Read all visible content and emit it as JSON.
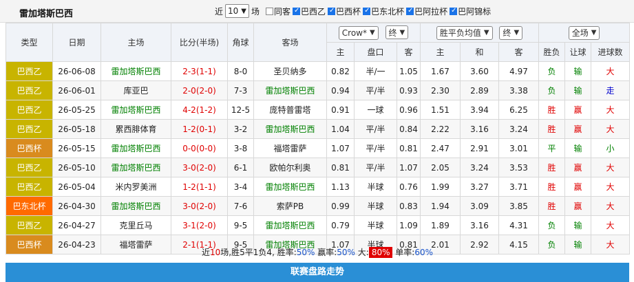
{
  "team_name": "雷加塔斯巴西",
  "filters": {
    "recent_label": "近",
    "count_value": "10",
    "unit_label": "场",
    "same_home_label": "同客",
    "same_home_checked": false,
    "leagues": [
      {
        "label": "巴西乙",
        "checked": true
      },
      {
        "label": "巴西杯",
        "checked": true
      },
      {
        "label": "巴东北杯",
        "checked": true
      },
      {
        "label": "巴阿拉杯",
        "checked": true
      },
      {
        "label": "巴阿锦标",
        "checked": true
      }
    ]
  },
  "headers": {
    "type": "类型",
    "date": "日期",
    "home": "主场",
    "score": "比分(半场)",
    "corner": "角球",
    "away": "客场",
    "bookmaker_select": "Crow*",
    "asian_period_select": "终",
    "eu_type_select": "胜平负均值",
    "eu_period_select": "终",
    "range_select": "全场",
    "asian_sub": [
      "主",
      "盘口",
      "客"
    ],
    "eu_sub": [
      "主",
      "和",
      "客"
    ],
    "result_sub": [
      "胜负",
      "让球",
      "进球数"
    ]
  },
  "league_colors": {
    "巴西乙": "#c8b400",
    "巴西杯": "#d98b1e",
    "巴东北杯": "#ff6a00"
  },
  "matches": [
    {
      "league": "巴西乙",
      "date": "26-06-08",
      "home": "雷加塔斯巴西",
      "score": "2-3(1-1)",
      "corner": "8-0",
      "away": "圣贝纳多",
      "a_home": "0.82",
      "handicap": "半/一",
      "a_away": "1.05",
      "e_home": "1.67",
      "e_draw": "3.60",
      "e_away": "4.97",
      "res": "负",
      "hcp_res": "输",
      "goal_res": "大"
    },
    {
      "league": "巴西乙",
      "date": "26-06-01",
      "home": "库亚巴",
      "score": "2-0(2-0)",
      "corner": "7-3",
      "away": "雷加塔斯巴西",
      "a_home": "0.94",
      "handicap": "平/半",
      "a_away": "0.93",
      "e_home": "2.30",
      "e_draw": "2.89",
      "e_away": "3.38",
      "res": "负",
      "hcp_res": "输",
      "goal_res": "走"
    },
    {
      "league": "巴西乙",
      "date": "26-05-25",
      "home": "雷加塔斯巴西",
      "score": "4-2(1-2)",
      "corner": "12-5",
      "away": "庞特普雷塔",
      "a_home": "0.91",
      "handicap": "一球",
      "a_away": "0.96",
      "e_home": "1.51",
      "e_draw": "3.94",
      "e_away": "6.25",
      "res": "胜",
      "hcp_res": "赢",
      "goal_res": "大"
    },
    {
      "league": "巴西乙",
      "date": "26-05-18",
      "home": "累西腓体育",
      "score": "1-2(0-1)",
      "corner": "3-2",
      "away": "雷加塔斯巴西",
      "a_home": "1.04",
      "handicap": "平/半",
      "a_away": "0.84",
      "e_home": "2.22",
      "e_draw": "3.16",
      "e_away": "3.24",
      "res": "胜",
      "hcp_res": "赢",
      "goal_res": "大"
    },
    {
      "league": "巴西杯",
      "date": "26-05-15",
      "home": "雷加塔斯巴西",
      "score": "0-0(0-0)",
      "corner": "3-8",
      "away": "福塔雷萨",
      "a_home": "1.07",
      "handicap": "平/半",
      "a_away": "0.81",
      "e_home": "2.47",
      "e_draw": "2.91",
      "e_away": "3.01",
      "res": "平",
      "hcp_res": "输",
      "goal_res": "小"
    },
    {
      "league": "巴西乙",
      "date": "26-05-10",
      "home": "雷加塔斯巴西",
      "score": "3-0(2-0)",
      "corner": "6-1",
      "away": "欧帕尔利奥",
      "a_home": "0.81",
      "handicap": "平/半",
      "a_away": "1.07",
      "e_home": "2.05",
      "e_draw": "3.24",
      "e_away": "3.53",
      "res": "胜",
      "hcp_res": "赢",
      "goal_res": "大"
    },
    {
      "league": "巴西乙",
      "date": "26-05-04",
      "home": "米内罗美洲",
      "score": "1-2(1-1)",
      "corner": "3-4",
      "away": "雷加塔斯巴西",
      "a_home": "1.13",
      "handicap": "半球",
      "a_away": "0.76",
      "e_home": "1.99",
      "e_draw": "3.27",
      "e_away": "3.71",
      "res": "胜",
      "hcp_res": "赢",
      "goal_res": "大"
    },
    {
      "league": "巴东北杯",
      "date": "26-04-30",
      "home": "雷加塔斯巴西",
      "score": "3-0(2-0)",
      "corner": "7-6",
      "away": "索萨PB",
      "a_home": "0.99",
      "handicap": "半球",
      "a_away": "0.83",
      "e_home": "1.94",
      "e_draw": "3.09",
      "e_away": "3.85",
      "res": "胜",
      "hcp_res": "赢",
      "goal_res": "大"
    },
    {
      "league": "巴西乙",
      "date": "26-04-27",
      "home": "克里丘马",
      "score": "3-1(2-0)",
      "corner": "9-5",
      "away": "雷加塔斯巴西",
      "a_home": "0.79",
      "handicap": "半球",
      "a_away": "1.09",
      "e_home": "1.89",
      "e_draw": "3.16",
      "e_away": "4.31",
      "res": "负",
      "hcp_res": "输",
      "goal_res": "大"
    },
    {
      "league": "巴西杯",
      "date": "26-04-23",
      "home": "福塔雷萨",
      "score": "2-1(1-1)",
      "corner": "9-5",
      "away": "雷加塔斯巴西",
      "a_home": "1.07",
      "handicap": "半球",
      "a_away": "0.81",
      "e_home": "2.01",
      "e_draw": "2.92",
      "e_away": "4.15",
      "res": "负",
      "hcp_res": "输",
      "goal_res": "大"
    }
  ],
  "summary": {
    "p1": "近",
    "games": "10",
    "p2": "场,胜",
    "wins": "5",
    "p3": "平",
    "draws": "1",
    "p4": "负",
    "losses": "4",
    "p5": ", 胜率:",
    "win_rate": "50%",
    "p6": " 赢率:",
    "cover_rate": "50%",
    "p7": " 大:",
    "over_rate": "80%",
    "p8": " 单率:",
    "odd_rate": "60%"
  },
  "footer_label": "联赛盘路走势"
}
